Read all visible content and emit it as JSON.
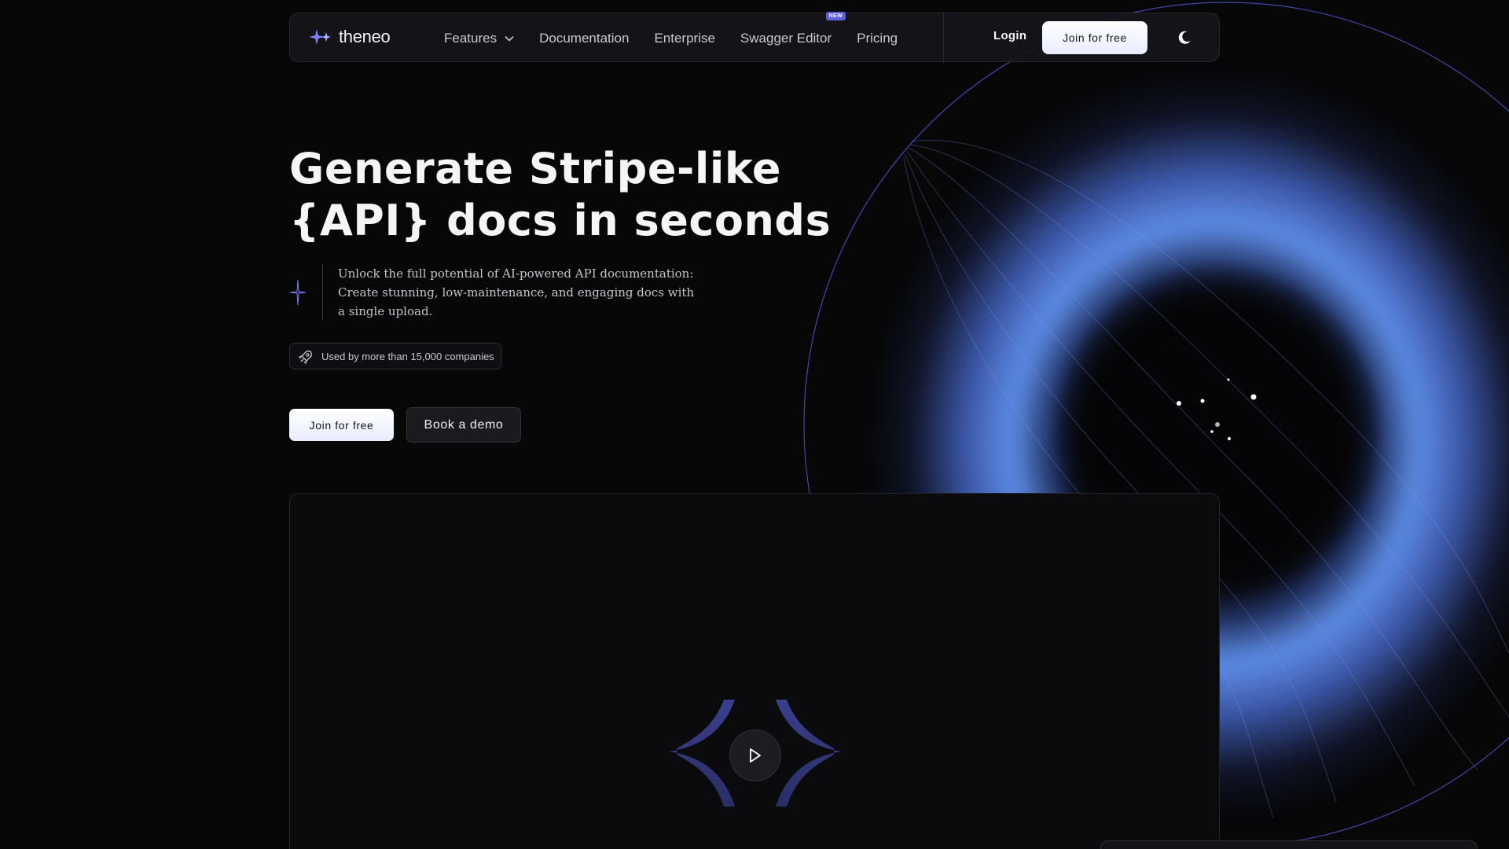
{
  "brand": {
    "name": "theneo",
    "logo_icon": "theneo-sparkle-logo-icon",
    "accent": "#6d71f5"
  },
  "nav": {
    "items": [
      {
        "label": "Features",
        "has_dropdown": true
      },
      {
        "label": "Documentation"
      },
      {
        "label": "Enterprise"
      },
      {
        "label": "Swagger Editor",
        "badge": "NEW"
      },
      {
        "label": "Pricing"
      }
    ],
    "login_label": "Login",
    "join_label": "Join for free",
    "theme_icon": "moon-icon"
  },
  "hero": {
    "title_line1": "Generate Stripe-like",
    "title_line2": "{API} docs in seconds",
    "description": "Unlock the full potential of AI-powered API documentation: Create stunning, low-maintenance, and engaging docs with a single upload.",
    "social_proof": "Used by more than 15,000 companies",
    "primary_cta": "Join for free",
    "secondary_cta": "Book a demo"
  },
  "video": {
    "play_icon": "play-icon"
  },
  "colors": {
    "background": "#070708",
    "glow": "#6496f5",
    "card": "#0b0b0d"
  }
}
